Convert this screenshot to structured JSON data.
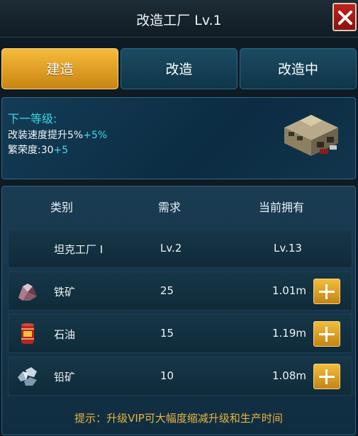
{
  "title": "改造工厂 Lv.1",
  "tabs": [
    {
      "label": "建造",
      "active": true
    },
    {
      "label": "改造",
      "active": false
    },
    {
      "label": "改造中",
      "active": false
    }
  ],
  "info": {
    "heading": "下一等级:",
    "line1_text": "改装速度提升5%",
    "line1_bonus": "+5%",
    "line2_text": "繁荣度:30",
    "line2_bonus": "+5"
  },
  "table": {
    "headers": [
      "类别",
      "需求",
      "当前拥有"
    ],
    "rows": [
      {
        "icon": "none",
        "name": "坦克工厂 I",
        "required": "Lv.2",
        "owned": "Lv.13",
        "has_plus": false
      },
      {
        "icon": "iron-ore-icon",
        "name": "铁矿",
        "required": "25",
        "owned": "1.01m",
        "has_plus": true
      },
      {
        "icon": "oil-barrel-icon",
        "name": "石油",
        "required": "15",
        "owned": "1.19m",
        "has_plus": true
      },
      {
        "icon": "lead-ore-icon",
        "name": "铅矿",
        "required": "10",
        "owned": "1.08m",
        "has_plus": true
      }
    ]
  },
  "hint": "提示：升级VIP可大幅度缩减升级和生产时间",
  "colors": {
    "accent_gold": "#e7b443",
    "bonus_cyan": "#42d8e8",
    "panel_blue": "#143c56"
  }
}
